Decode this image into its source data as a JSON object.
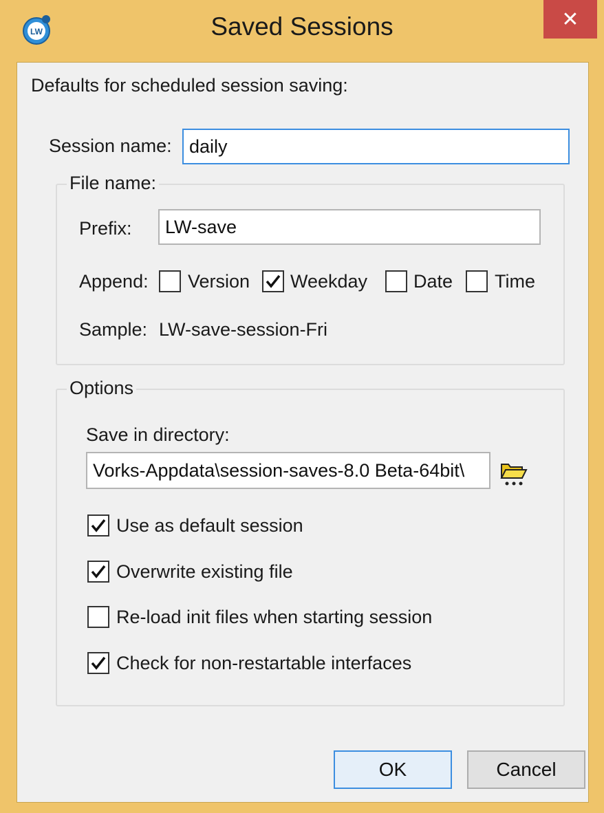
{
  "window": {
    "title": "Saved Sessions",
    "close_glyph": "✕",
    "app_icon_text": "LW"
  },
  "intro_label": "Defaults for scheduled session saving:",
  "session_name": {
    "label": "Session name:",
    "value": "daily"
  },
  "file_name_group": {
    "title": "File name:",
    "prefix": {
      "label": "Prefix:",
      "value": "LW-save"
    },
    "append": {
      "label": "Append:",
      "options": [
        {
          "label": "Version",
          "checked": false
        },
        {
          "label": "Weekday",
          "checked": true
        },
        {
          "label": "Date",
          "checked": false
        },
        {
          "label": "Time",
          "checked": false
        }
      ]
    },
    "sample": {
      "label": "Sample:",
      "value": "LW-save-session-Fri"
    }
  },
  "options_group": {
    "title": "Options",
    "directory": {
      "label": "Save in directory:",
      "value": "Vorks-Appdata\\session-saves-8.0 Beta-64bit\\"
    },
    "checkboxes": [
      {
        "label": "Use as default session",
        "checked": true
      },
      {
        "label": "Overwrite existing file",
        "checked": true
      },
      {
        "label": "Re-load init files when starting session",
        "checked": false
      },
      {
        "label": "Check for non-restartable interfaces",
        "checked": true
      }
    ]
  },
  "buttons": {
    "ok": "OK",
    "cancel": "Cancel"
  },
  "icons": {
    "close": "close-icon",
    "app": "app-logo-icon",
    "folder": "folder-browse-icon",
    "check": "checkmark-icon"
  },
  "colors": {
    "title_bar": "#efc46a",
    "close_button": "#c94a46",
    "focus_border": "#3c8ee0",
    "dialog_bg": "#f0f0f0"
  }
}
